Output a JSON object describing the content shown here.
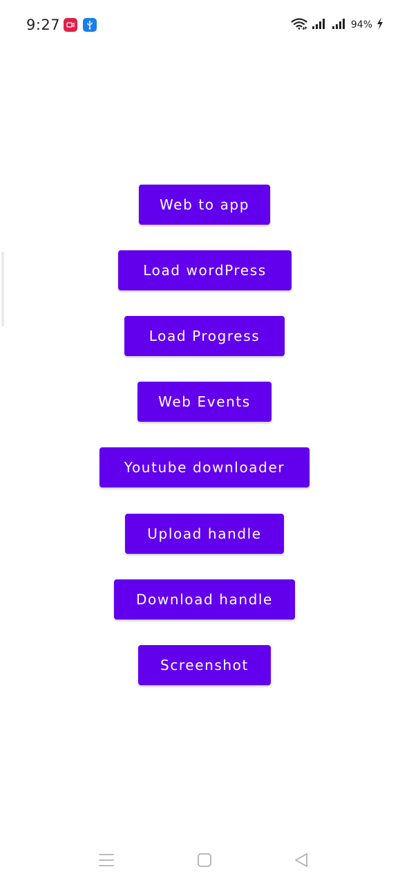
{
  "status_bar": {
    "time": "9:27",
    "battery": "94%",
    "icons": [
      "screen-recorder-icon",
      "usb-icon",
      "wifi-icon",
      "signal-icon",
      "signal-icon",
      "charging-icon"
    ]
  },
  "buttons": [
    {
      "label": "Web to app"
    },
    {
      "label": "Load wordPress"
    },
    {
      "label": "Load Progress"
    },
    {
      "label": "Web Events"
    },
    {
      "label": "Youtube downloader"
    },
    {
      "label": "Upload handle"
    },
    {
      "label": "Download handle"
    },
    {
      "label": "Screenshot"
    }
  ],
  "nav_bar": {
    "icons": [
      "menu-icon",
      "home-icon",
      "back-icon"
    ]
  },
  "colors": {
    "button_bg": "#6200ee",
    "button_text": "#ffffff",
    "background": "#ffffff"
  }
}
